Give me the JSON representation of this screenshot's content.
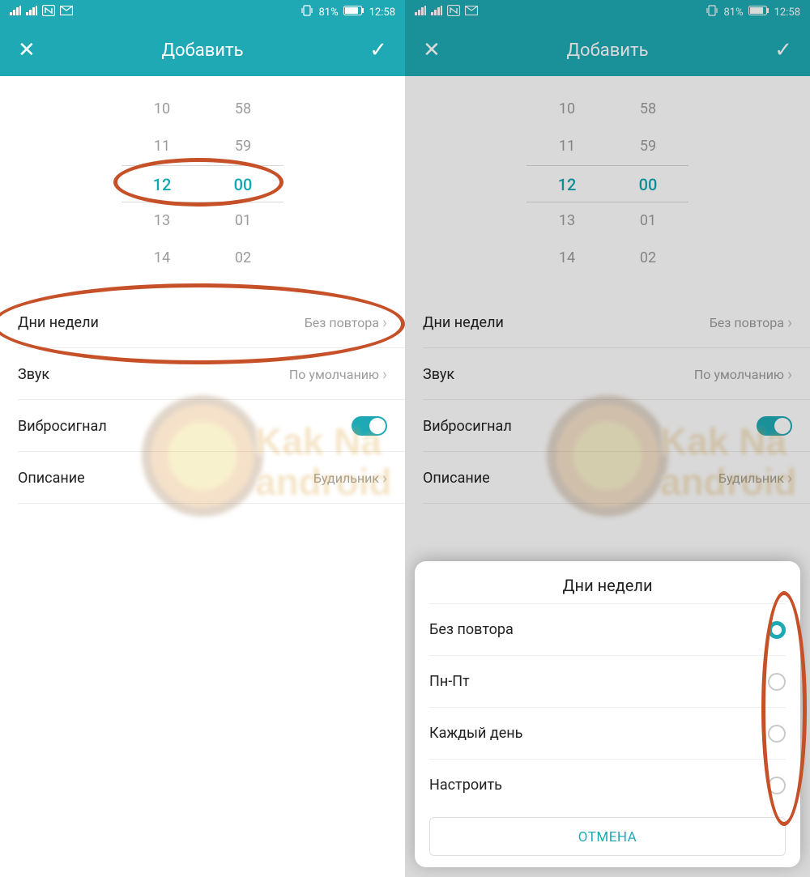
{
  "status": {
    "battery": "81%",
    "time": "12:58"
  },
  "header": {
    "title": "Добавить"
  },
  "picker": {
    "hours": [
      "10",
      "11",
      "12",
      "13",
      "14"
    ],
    "minutes": [
      "58",
      "59",
      "00",
      "01",
      "02"
    ],
    "selected_index": 2
  },
  "rows": {
    "days": {
      "label": "Дни недели",
      "value": "Без повтора"
    },
    "sound": {
      "label": "Звук",
      "value": "По умолчанию"
    },
    "vibrate": {
      "label": "Вибросигнал"
    },
    "desc": {
      "label": "Описание",
      "value": "Будильник"
    }
  },
  "dialog": {
    "title": "Дни недели",
    "options": [
      "Без повтора",
      "Пн-Пт",
      "Каждый день",
      "Настроить"
    ],
    "selected": 0,
    "cancel": "ОТМЕНА"
  },
  "watermark": {
    "line1": "Kak Na",
    "line2": "android"
  }
}
